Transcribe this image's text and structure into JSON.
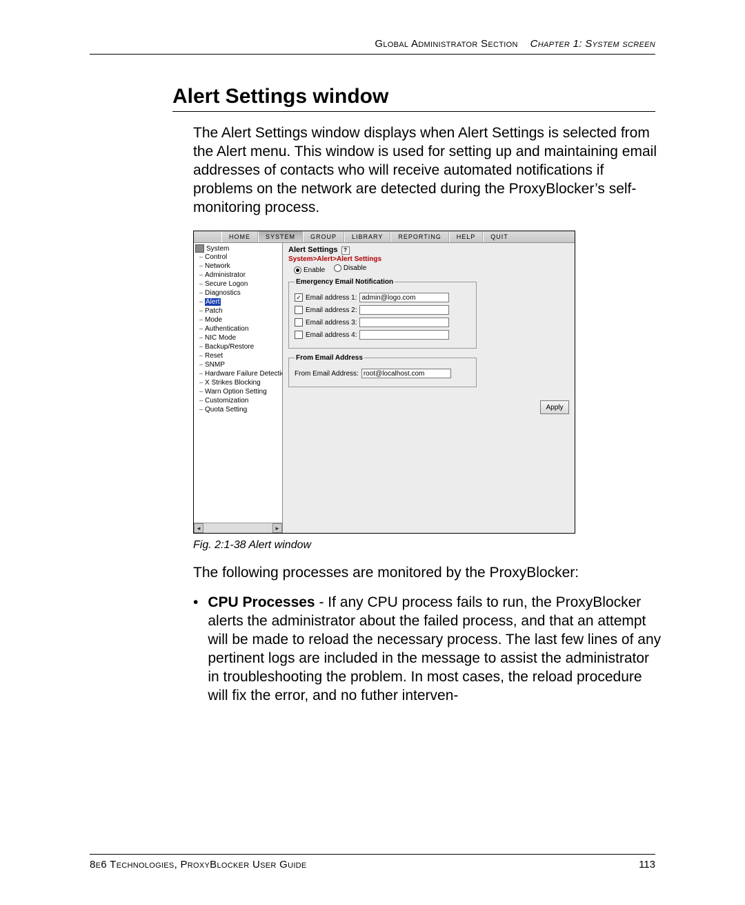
{
  "header": {
    "left": "Global Administrator Section",
    "right": "Chapter 1: System screen"
  },
  "title": "Alert Settings window",
  "intro": "The Alert Settings window displays when Alert Settings is selected from the Alert menu. This window is used for setting up and maintaining email addresses of contacts who will receive automated notifications if problems on the network are detected during the ProxyBlocker’s self-monitoring process.",
  "figure": {
    "menubar": [
      "HOME",
      "SYSTEM",
      "GROUP",
      "LIBRARY",
      "REPORTING",
      "HELP",
      "QUIT"
    ],
    "active_menu_index": 1,
    "tree_root": "System",
    "tree_items": [
      "Control",
      "Network",
      "Administrator",
      "Secure Logon",
      "Diagnostics",
      "Alert",
      "Patch",
      "Mode",
      "Authentication",
      "NIC Mode",
      "Backup/Restore",
      "Reset",
      "SNMP",
      "Hardware Failure Detection",
      "X Strikes Blocking",
      "Warn Option Setting",
      "Customization",
      "Quota Setting"
    ],
    "tree_selected_index": 5,
    "panel_title": "Alert Settings",
    "breadcrumb": "System>Alert>Alert Settings",
    "enable_label": "Enable",
    "disable_label": "Disable",
    "enabled": true,
    "group1_legend": "Emergency Email Notification",
    "emails": [
      {
        "label": "Email address 1:",
        "checked": true,
        "value": "admin@logo.com"
      },
      {
        "label": "Email address 2:",
        "checked": false,
        "value": ""
      },
      {
        "label": "Email address 3:",
        "checked": false,
        "value": ""
      },
      {
        "label": "Email address 4:",
        "checked": false,
        "value": ""
      }
    ],
    "group2_legend": "From Email Address",
    "from_label": "From Email Address:",
    "from_value": "root@localhost.com",
    "apply_label": "Apply"
  },
  "caption": "Fig. 2:1-38  Alert window",
  "para2": "The following processes are monitored by the ProxyBlocker:",
  "bullet_label": "CPU Processes",
  "bullet_text": " - If any CPU process fails to run, the ProxyBlocker alerts the administrator about the failed process, and that an attempt will be made to reload the necessary process. The last few lines of any pertinent logs are included in the message to assist the administrator in troubleshooting the problem. In most cases, the reload procedure will fix the error, and no futher interven-",
  "footer": {
    "left": "8e6 Technologies, ProxyBlocker User Guide",
    "right": "113"
  }
}
